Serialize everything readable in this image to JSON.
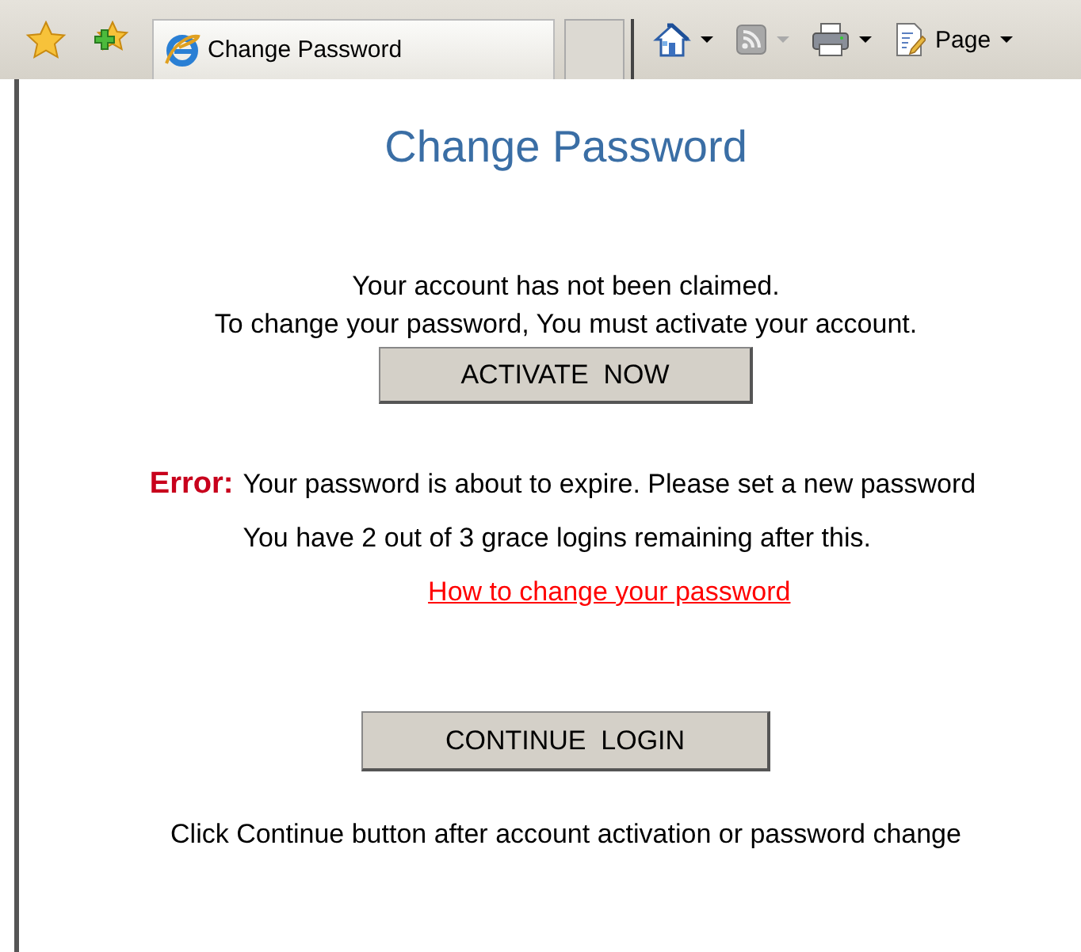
{
  "toolbar": {
    "tab": {
      "title": "Change Password",
      "selected": true
    },
    "tools": [
      {
        "kind": "home",
        "disabled": false
      },
      {
        "kind": "feed",
        "disabled": true
      },
      {
        "kind": "print",
        "disabled": false
      },
      {
        "kind": "page",
        "label": "Page",
        "disabled": false
      }
    ]
  },
  "page": {
    "title": "Change Password",
    "notice": [
      "Your account has not been claimed.",
      "To change your password, You must activate your account."
    ],
    "activate_button": "ACTIVATE  NOW",
    "error": {
      "label": "Error:",
      "message": "Your password is about to expire. Please set a new password",
      "grace": "You have 2 out of 3 grace logins remaining after this.",
      "link": "How to change your password"
    },
    "continue_button": "CONTINUE  LOGIN",
    "footer": "Click Continue button after account activation or password change"
  }
}
